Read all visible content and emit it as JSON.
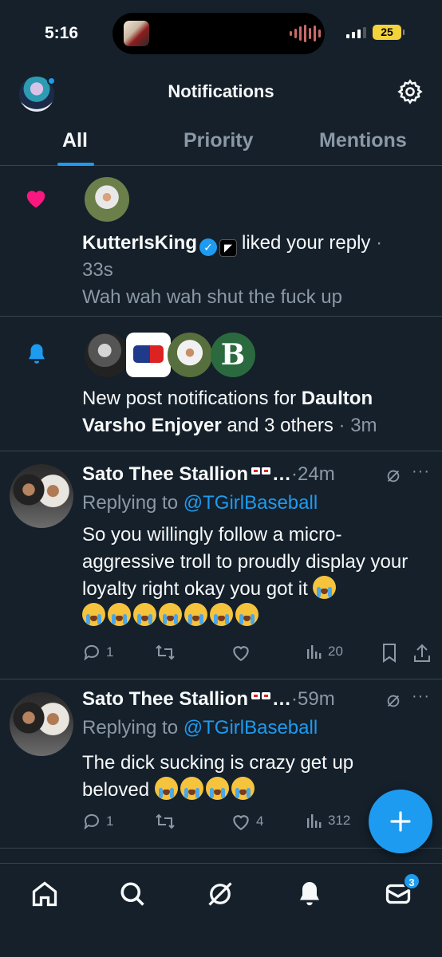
{
  "status_bar": {
    "time": "5:16",
    "battery": "25"
  },
  "header": {
    "title": "Notifications"
  },
  "tabs": [
    {
      "label": "All",
      "active": true
    },
    {
      "label": "Priority",
      "active": false
    },
    {
      "label": "Mentions",
      "active": false
    }
  ],
  "notifications": [
    {
      "type": "like",
      "icon": "heart-icon",
      "user": "KutterIsKing",
      "action": "liked your reply",
      "sep": " ·",
      "time": "33s",
      "snippet": "Wah wah wah shut the fuck up"
    },
    {
      "type": "new-post",
      "icon": "bell-icon",
      "text_pre": "New post notifications for ",
      "name_bold": "Daulton Varsho Enjoyer",
      "text_post": " and 3 others",
      "time": " · 3m"
    }
  ],
  "replies": [
    {
      "author": "Sato Thee Stallion",
      "ellipsis": "…",
      "time": "·24m",
      "replying_prefix": "Replying to ",
      "replying_to": "@TGirlBaseball",
      "text": "So you willingly follow a micro-aggressive troll to proudly display your loyalty right okay you got it",
      "emoji_inline": 1,
      "emoji_row": 7,
      "replies": "1",
      "reposts": "",
      "likes": "",
      "views": "20"
    },
    {
      "author": "Sato Thee Stallion",
      "ellipsis": "…",
      "time": "·59m",
      "replying_prefix": "Replying to ",
      "replying_to": "@TGirlBaseball",
      "text": "The dick sucking is crazy get up beloved",
      "emoji_inline": 4,
      "replies": "1",
      "reposts": "",
      "likes": "4",
      "views": "312"
    }
  ],
  "bottom_nav": {
    "items": [
      "home-icon",
      "search-icon",
      "grok-icon",
      "notifications-icon",
      "messages-icon"
    ],
    "messages_badge": "3"
  },
  "colors": {
    "background": "#15202b",
    "accent": "#1d9bf0",
    "like": "#f91880",
    "muted": "#8b98a5"
  }
}
